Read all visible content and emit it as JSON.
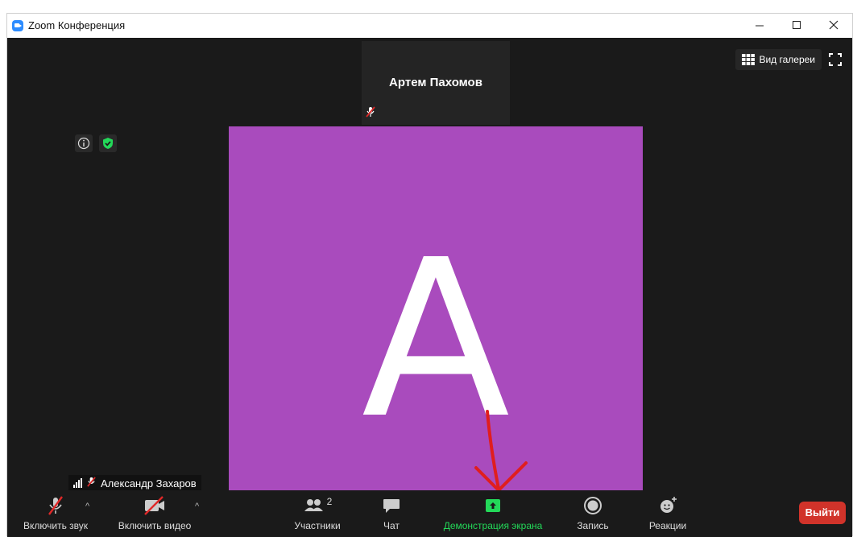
{
  "window": {
    "title": "Zoom Конференция",
    "controls": {
      "minimize": "–",
      "maximize": "☐",
      "close": "✕"
    }
  },
  "top_right": {
    "gallery_view_label": "Вид галереи",
    "gallery_icon": "grid-icon",
    "fullscreen_icon": "fullscreen-icon"
  },
  "speaker": {
    "name": "Артем Пахомов",
    "mic_state": "muted"
  },
  "main_participant": {
    "avatar_letter": "A",
    "avatar_color": "#a94bbd",
    "name": "Александр Захаров",
    "mic_state": "muted"
  },
  "meeting_info": {
    "info_icon": "info-icon",
    "security_icon": "shield-check-icon",
    "security_color": "#23d959"
  },
  "toolbar": {
    "unmute_label": "Включить звук",
    "start_video_label": "Включить видео",
    "participants_label": "Участники",
    "participants_count": "2",
    "chat_label": "Чат",
    "share_screen_label": "Демонстрация экрана",
    "record_label": "Запись",
    "reactions_label": "Реакции",
    "leave_label": "Выйти",
    "share_color": "#23d959",
    "leave_color": "#d1332a"
  }
}
